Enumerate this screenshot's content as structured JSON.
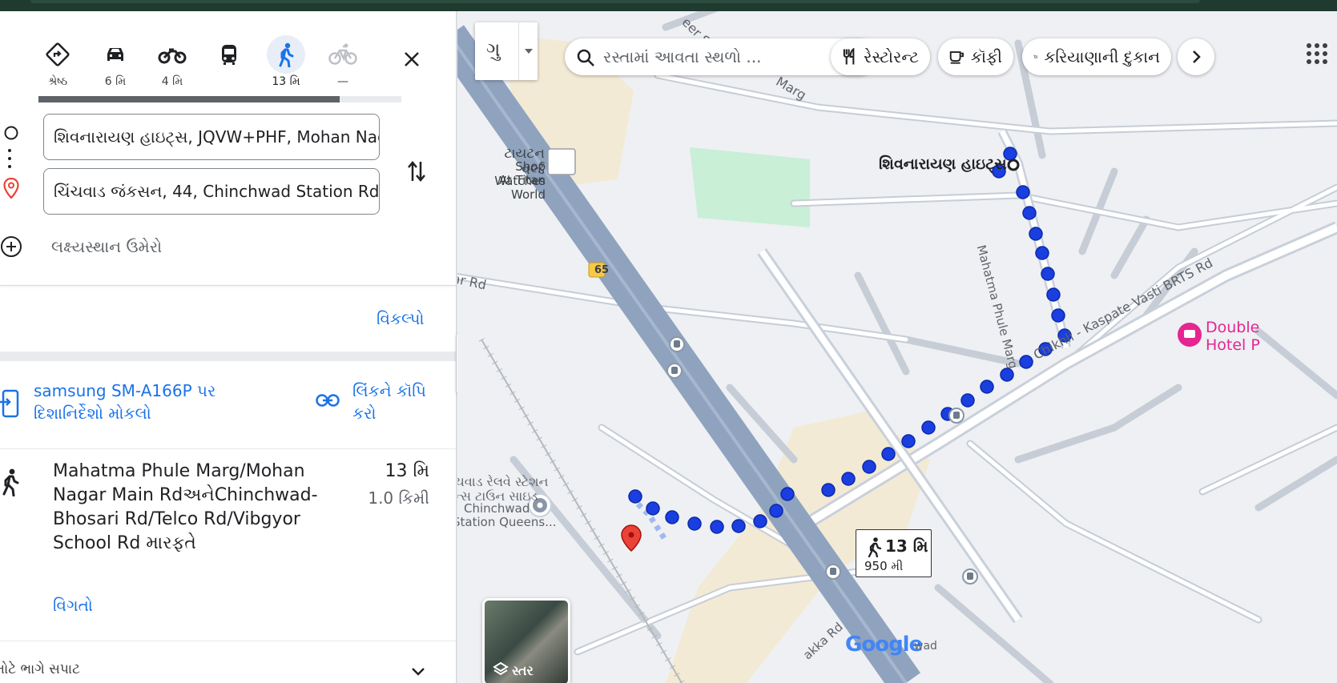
{
  "modes": [
    {
      "label": "શ્રેષ્ઠ",
      "icon": "best-route-icon"
    },
    {
      "label": "6 મિ",
      "icon": "car-icon"
    },
    {
      "label": "4 મિ",
      "icon": "motorcycle-icon"
    },
    {
      "label": "",
      "icon": "transit-icon"
    },
    {
      "label": "13 મિ",
      "icon": "walk-icon"
    },
    {
      "label": "—",
      "icon": "bicycle-icon"
    }
  ],
  "route": {
    "origin": "શિવનારાયણ હાઇટ્સ, JQVW+PHF, Mohan Nagar",
    "destination": "ચિંચવાડ જંકસન, 44, Chinchwad Station Rd, ",
    "add_destination": "લક્ષ્યસ્થાન ઉમેરો"
  },
  "options_label": "વિકલ્પો",
  "send": {
    "line1": "samsung SM-A166P પર",
    "line2": "દિશાનિર્દેશો મોકલો",
    "copy_line1": "લિંકને કૉપિ",
    "copy_line2": "કરો"
  },
  "trip": {
    "via": "Mahatma Phule Marg/Mohan Nagar Main RdઅનેChinchwad-Bhosari Rd/Telco Rd/Vibgyor School Rd મારફતે",
    "duration": "13 મિ",
    "distance": "1.0 કિમી",
    "details": "વિગતો"
  },
  "footer_text": "મોટે ભાગે સપાટ",
  "map": {
    "lang": "ગુ",
    "search_placeholder": "રસ્તામાં આવતા સ્થળો ...",
    "chips": [
      "રેસ્ટોરન્ટ",
      "કૉફી",
      "કરિયાણાની દુકાન"
    ],
    "labels": {
      "titan_gu": "ટાયટન વર્લ્ડ",
      "titan_en1": "Shop Watches",
      "titan_en2": "At Titan World",
      "origin": "શિવનારાયણ હાઇટ્સ",
      "road_mpm": "Mahatma Phule Marg",
      "road_brts": "Chikhli - Kaspate Vasti BRTS Rd",
      "road_ar": "ar Rd",
      "road_marg": "Marg",
      "road_eer": "eer S",
      "highway": "65",
      "station_gu1": "ચવાડ રેલવે સ્ટેશન",
      "station_gu2": "ન્સ ટાઉન સાઇડ",
      "station_en1": "Chinchwad",
      "station_en2": "Station Queens...",
      "hotel1": "Double",
      "hotel2": "Hotel P",
      "road_bottom": "akka Rd",
      "google": "Google",
      "wad": "wad"
    },
    "callout": {
      "duration": "13 મિ",
      "distance": "950 મી"
    },
    "layers_label": "સ્તર"
  },
  "colors": {
    "accent": "#1a73e8",
    "route": "#1a3ee0",
    "highway": "#8fa3bf",
    "pin": "#ea4335"
  }
}
